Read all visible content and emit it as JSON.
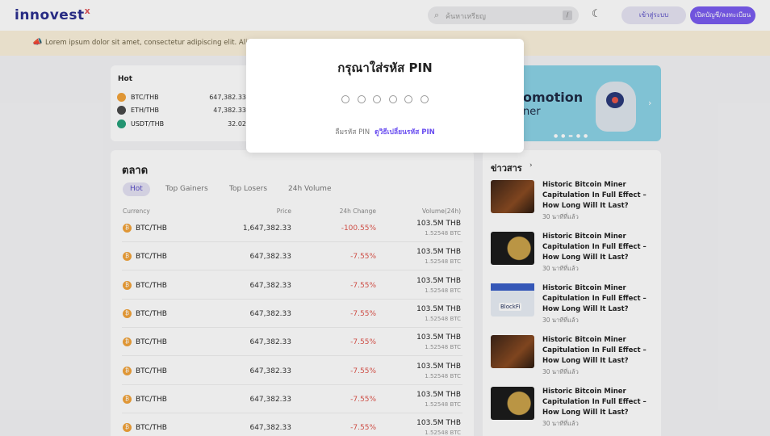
{
  "header": {
    "logo": "innovest",
    "logo_mark": "x",
    "search_placeholder": "ค้นหาเหรียญ",
    "search_shortcut": "/",
    "theme_icon": "moon-icon",
    "login_label": "เข้าสู่ระบบ",
    "register_label": "เปิดบัญชี/ลงทะเบียน"
  },
  "announcement": {
    "icon": "megaphone-icon",
    "text": "Lorem ipsum dolor sit amet, consectetur adipiscing elit. Aliquam p...                                                                   scelerisque. Morbi gravida ante et pulvinar congue. Fusce hendrerit..."
  },
  "hot": {
    "title": "Hot",
    "items": [
      {
        "symbol": "BTC/THB",
        "price": "647,382.33",
        "color": "#f2a33a"
      },
      {
        "symbol": "ETH/THB",
        "price": "47,382.33",
        "color": "#4a4a4a"
      },
      {
        "symbol": "USDT/THB",
        "price": "32.02",
        "color": "#26a17b"
      }
    ]
  },
  "banner": {
    "title": "omotion",
    "subtitle": "ner",
    "next_icon": "chevron-right-icon"
  },
  "market": {
    "title": "ตลาด",
    "tabs": [
      "Hot",
      "Top Gainers",
      "Top Losers",
      "24h Volume"
    ],
    "columns": {
      "currency": "Currency",
      "price": "Price",
      "change": "24h Change",
      "volume": "Volume(24h)"
    },
    "rows": [
      {
        "symbol": "BTC/THB",
        "price": "1,647,382.33",
        "change": "-100.55%",
        "volume": "103.5M THB",
        "volume_btc": "1.52548 BTC"
      },
      {
        "symbol": "BTC/THB",
        "price": "647,382.33",
        "change": "-7.55%",
        "volume": "103.5M THB",
        "volume_btc": "1.52548 BTC"
      },
      {
        "symbol": "BTC/THB",
        "price": "647,382.33",
        "change": "-7.55%",
        "volume": "103.5M THB",
        "volume_btc": "1.52548 BTC"
      },
      {
        "symbol": "BTC/THB",
        "price": "647,382.33",
        "change": "-7.55%",
        "volume": "103.5M THB",
        "volume_btc": "1.52548 BTC"
      },
      {
        "symbol": "BTC/THB",
        "price": "647,382.33",
        "change": "-7.55%",
        "volume": "103.5M THB",
        "volume_btc": "1.52548 BTC"
      },
      {
        "symbol": "BTC/THB",
        "price": "647,382.33",
        "change": "-7.55%",
        "volume": "103.5M THB",
        "volume_btc": "1.52548 BTC"
      },
      {
        "symbol": "BTC/THB",
        "price": "647,382.33",
        "change": "-7.55%",
        "volume": "103.5M THB",
        "volume_btc": "1.52548 BTC"
      },
      {
        "symbol": "BTC/THB",
        "price": "647,382.33",
        "change": "-7.55%",
        "volume": "103.5M THB",
        "volume_btc": "1.52548 BTC"
      }
    ]
  },
  "news": {
    "title": "ข่าวสาร",
    "items": [
      {
        "title": "Historic Bitcoin Miner Capitulation In Full Effect – How Long Will It Last?",
        "time": "30 นาทีที่แล้ว",
        "thumb": "t-btc"
      },
      {
        "title": "Historic Bitcoin Miner Capitulation In Full Effect – How Long Will It Last?",
        "time": "30 นาทีที่แล้ว",
        "thumb": "t-coin"
      },
      {
        "title": "Historic Bitcoin Miner Capitulation In Full Effect – How Long Will It Last?",
        "time": "30 นาทีที่แล้ว",
        "thumb": "t-block"
      },
      {
        "title": "Historic Bitcoin Miner Capitulation In Full Effect – How Long Will It Last?",
        "time": "30 นาทีที่แล้ว",
        "thumb": "t-btc"
      },
      {
        "title": "Historic Bitcoin Miner Capitulation In Full Effect – How Long Will It Last?",
        "time": "30 นาทีที่แล้ว",
        "thumb": "t-coin"
      }
    ]
  },
  "modal": {
    "title": "กรุณาใส่รหัส PIN",
    "pin_length": 6,
    "forgot_label": "ลืมรหัส PIN",
    "forgot_link": "ดูวิธีเปลี่ยนรหัส PIN"
  }
}
